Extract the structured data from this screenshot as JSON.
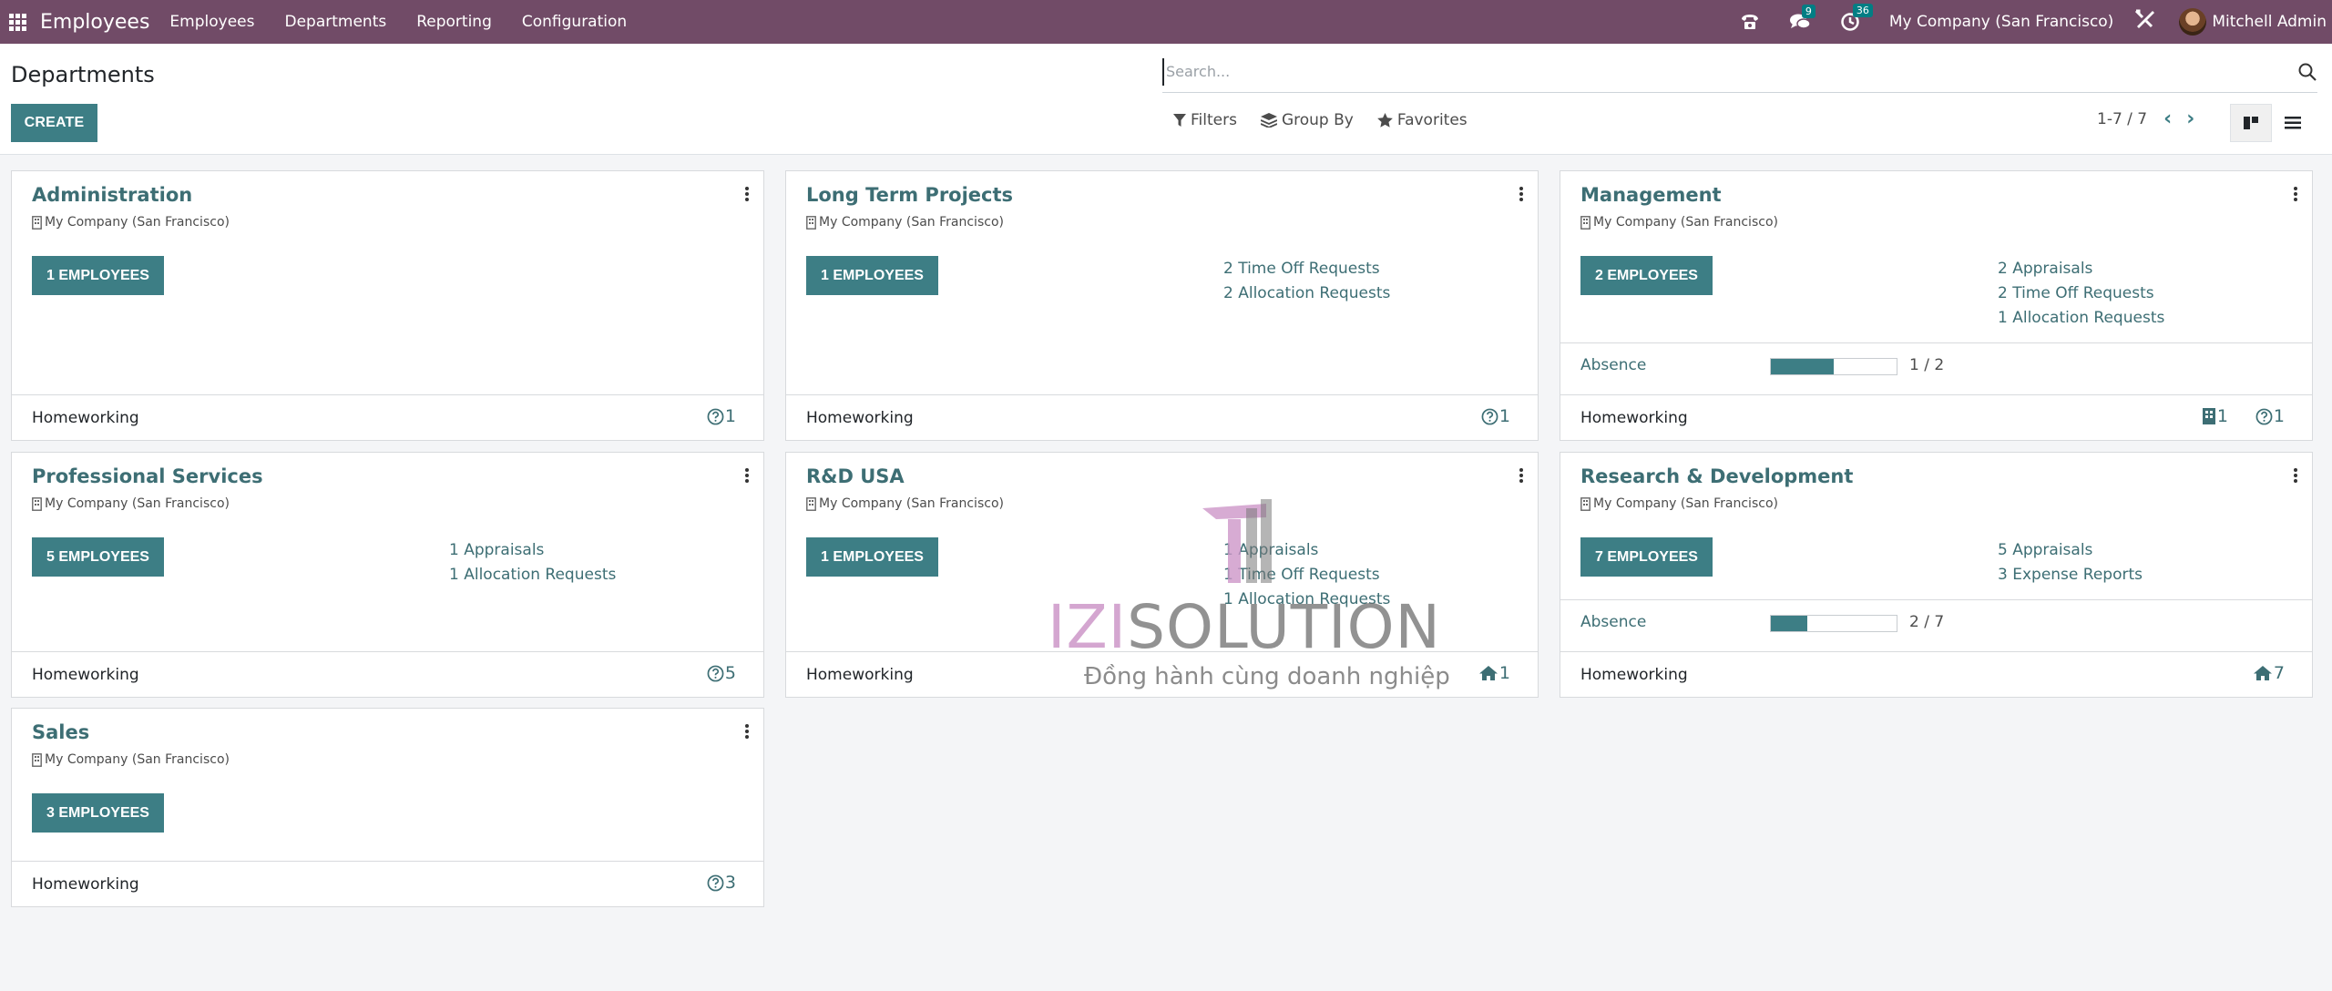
{
  "navbar": {
    "app_name": "Employees",
    "menu": [
      "Employees",
      "Departments",
      "Reporting",
      "Configuration"
    ],
    "messages_count": "9",
    "activities_count": "36",
    "company": "My Company (San Francisco)",
    "user_name": "Mitchell Admin"
  },
  "control_panel": {
    "title": "Departments",
    "create_label": "CREATE",
    "search_placeholder": "Search...",
    "filters_label": "Filters",
    "group_by_label": "Group By",
    "favorites_label": "Favorites",
    "pager": "1-7 / 7",
    "active_view": "kanban"
  },
  "cards": [
    {
      "title": "Administration",
      "company": "My Company (San Francisco)",
      "employees_label": "1 EMPLOYEES",
      "links": [],
      "absence": null,
      "footer_label": "Homeworking",
      "footer_stats": [
        {
          "icon": "question-icon",
          "value": "1"
        }
      ]
    },
    {
      "title": "Long Term Projects",
      "company": "My Company (San Francisco)",
      "employees_label": "1 EMPLOYEES",
      "links": [
        "2 Time Off Requests",
        "2 Allocation Requests"
      ],
      "absence": null,
      "footer_label": "Homeworking",
      "footer_stats": [
        {
          "icon": "question-icon",
          "value": "1"
        }
      ]
    },
    {
      "title": "Management",
      "company": "My Company (San Francisco)",
      "employees_label": "2 EMPLOYEES",
      "links": [
        "2 Appraisals",
        "2 Time Off Requests",
        "1 Allocation Requests"
      ],
      "absence": {
        "label": "Absence",
        "value": "1 / 2",
        "fraction": 0.5
      },
      "footer_label": "Homeworking",
      "footer_stats": [
        {
          "icon": "office-icon",
          "value": "1"
        },
        {
          "icon": "question-icon",
          "value": "1"
        }
      ]
    },
    {
      "title": "Professional Services",
      "company": "My Company (San Francisco)",
      "employees_label": "5 EMPLOYEES",
      "links": [
        "1 Appraisals",
        "1 Allocation Requests"
      ],
      "absence": null,
      "footer_label": "Homeworking",
      "footer_stats": [
        {
          "icon": "question-icon",
          "value": "5"
        }
      ]
    },
    {
      "title": "R&D USA",
      "company": "My Company (San Francisco)",
      "employees_label": "1 EMPLOYEES",
      "links": [
        "1 Appraisals",
        "1 Time Off Requests",
        "1 Allocation Requests"
      ],
      "absence": null,
      "footer_label": "Homeworking",
      "footer_stats": [
        {
          "icon": "home-icon",
          "value": "1"
        }
      ]
    },
    {
      "title": "Research & Development",
      "company": "My Company (San Francisco)",
      "employees_label": "7 EMPLOYEES",
      "links": [
        "5 Appraisals",
        "3 Expense Reports"
      ],
      "absence": {
        "label": "Absence",
        "value": "2 / 7",
        "fraction": 0.2857
      },
      "footer_label": "Homeworking",
      "footer_stats": [
        {
          "icon": "home-icon",
          "value": "7"
        }
      ]
    },
    {
      "title": "Sales",
      "company": "My Company (San Francisco)",
      "employees_label": "3 EMPLOYEES",
      "links": [],
      "absence": null,
      "footer_label": "Homeworking",
      "footer_stats": [
        {
          "icon": "question-icon",
          "value": "3"
        }
      ]
    }
  ],
  "watermark": {
    "brand_part1": "IZI",
    "brand_part2": "SOLUTION",
    "tagline": "Đồng hành cùng doanh nghiệp"
  }
}
